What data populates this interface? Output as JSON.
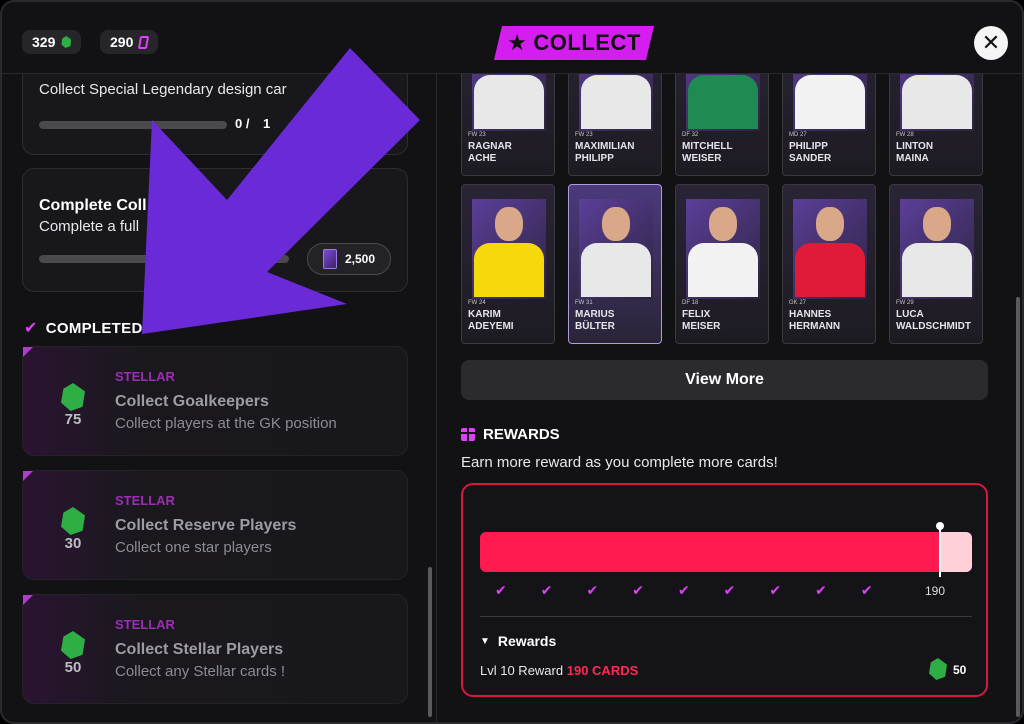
{
  "currency": [
    {
      "value": "329",
      "icon": "green-gem-icon",
      "color": "#2fae45"
    },
    {
      "value": "290",
      "icon": "pink-card-icon",
      "color": "#e040fb"
    }
  ],
  "header": {
    "title": "COLLECT",
    "star": "★",
    "close": "✕"
  },
  "quests": [
    {
      "desc": "Collect Special Legendary design car",
      "progress": "0 /",
      "progress_total": "1",
      "progress_fraction": 0
    },
    {
      "title": "Complete Coll",
      "desc": "Complete a full",
      "cost": "2,500",
      "progress_fraction": 0
    }
  ],
  "completed": {
    "label": "COMPLETED",
    "items": [
      {
        "tier": "STELLAR",
        "title": "Collect Goalkeepers",
        "desc": "Collect players at the GK position",
        "reward": "75"
      },
      {
        "tier": "STELLAR",
        "title": "Collect Reserve Players",
        "desc": "Collect one star players",
        "reward": "30"
      },
      {
        "tier": "STELLAR",
        "title": "Collect Stellar Players",
        "desc": "Collect any Stellar cards !",
        "reward": "50"
      }
    ]
  },
  "players": [
    {
      "first": "RAGNAR",
      "last": "ACHE",
      "stats": "FW 23",
      "shirt": "#e8e8e8"
    },
    {
      "first": "MAXIMILIAN",
      "last": "PHILIPP",
      "stats": "FW 23",
      "shirt": "#e8e8e8"
    },
    {
      "first": "MITCHELL",
      "last": "WEISER",
      "stats": "DF 32",
      "shirt": "#1f8a52"
    },
    {
      "first": "PHILIPP",
      "last": "SANDER",
      "stats": "MD 27",
      "shirt": "#f2f2f2"
    },
    {
      "first": "LINTON",
      "last": "MAINA",
      "stats": "FW 28",
      "shirt": "#e8e8e8"
    },
    {
      "first": "KARIM",
      "last": "ADEYEMI",
      "stats": "FW 24",
      "shirt": "#f5d90a"
    },
    {
      "first": "MARIUS",
      "last": "BÜLTER",
      "stats": "FW 31",
      "shirt": "#e8e8e8"
    },
    {
      "first": "FELIX",
      "last": "MEISER",
      "stats": "DF 18",
      "shirt": "#f2f2f2"
    },
    {
      "first": "HANNES",
      "last": "HERMANN",
      "stats": "GK 27",
      "shirt": "#e01b3a"
    },
    {
      "first": "LUCA",
      "last": "WALDSCHMIDT",
      "stats": "FW 29",
      "shirt": "#e8e8e8"
    }
  ],
  "view_more": "View More",
  "rewards": {
    "title": "REWARDS",
    "subtitle": "Earn more reward as you complete more cards!",
    "marker": "190",
    "progress_fraction": 0.93,
    "toggle": "Rewards",
    "level_text": "Lvl 10 Reward",
    "level_cards": "190 CARDS",
    "level_value": "50"
  }
}
